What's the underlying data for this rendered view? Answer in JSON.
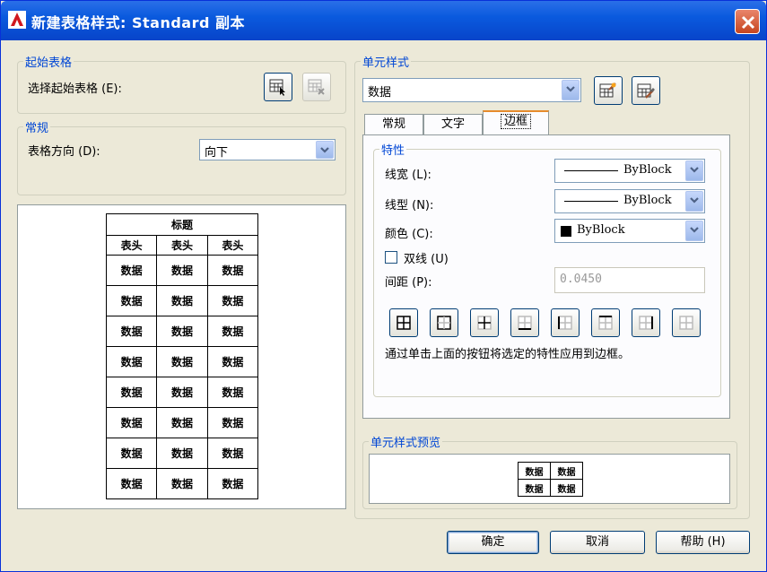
{
  "window": {
    "title": "新建表格样式: Standard 副本",
    "close_icon": "close-icon"
  },
  "start_table": {
    "legend": "起始表格",
    "label": "选择起始表格 (E):",
    "select_icon": "table-select-icon",
    "delete_icon": "table-delete-icon"
  },
  "general": {
    "legend": "常规",
    "direction_label": "表格方向 (D):",
    "direction_value": "向下"
  },
  "table_preview": {
    "title": "标题",
    "headers": [
      "表头",
      "表头",
      "表头"
    ],
    "rows": [
      [
        "数据",
        "数据",
        "数据"
      ],
      [
        "数据",
        "数据",
        "数据"
      ],
      [
        "数据",
        "数据",
        "数据"
      ],
      [
        "数据",
        "数据",
        "数据"
      ],
      [
        "数据",
        "数据",
        "数据"
      ],
      [
        "数据",
        "数据",
        "数据"
      ],
      [
        "数据",
        "数据",
        "数据"
      ],
      [
        "数据",
        "数据",
        "数据"
      ]
    ]
  },
  "cell_style": {
    "legend": "单元样式",
    "selected": "数据",
    "new_icon": "new-cell-style-icon",
    "manage_icon": "manage-cell-styles-icon",
    "tabs": [
      {
        "label": "常规",
        "active": false
      },
      {
        "label": "文字",
        "active": false
      },
      {
        "label": "边框",
        "active": true
      }
    ]
  },
  "properties": {
    "legend": "特性",
    "lineweight_label": "线宽 (L):",
    "lineweight_value": "ByBlock",
    "linetype_label": "线型 (N):",
    "linetype_value": "ByBlock",
    "color_label": "颜色 (C):",
    "color_value": "ByBlock",
    "color_swatch": "#000000",
    "double_line_label": "双线 (U)",
    "double_line_checked": false,
    "spacing_label": "间距 (P):",
    "spacing_value": "0.0450",
    "border_buttons": [
      "all-borders-icon",
      "outside-borders-icon",
      "inside-borders-icon",
      "bottom-border-icon",
      "left-border-icon",
      "top-border-icon",
      "right-border-icon",
      "no-border-icon"
    ],
    "hint": "通过单击上面的按钮将选定的特性应用到边框。"
  },
  "cell_preview": {
    "legend": "单元样式预览",
    "cells": [
      [
        "数据",
        "数据"
      ],
      [
        "数据",
        "数据"
      ]
    ]
  },
  "buttons": {
    "ok": "确定",
    "cancel": "取消",
    "help": "帮助 (H)"
  }
}
